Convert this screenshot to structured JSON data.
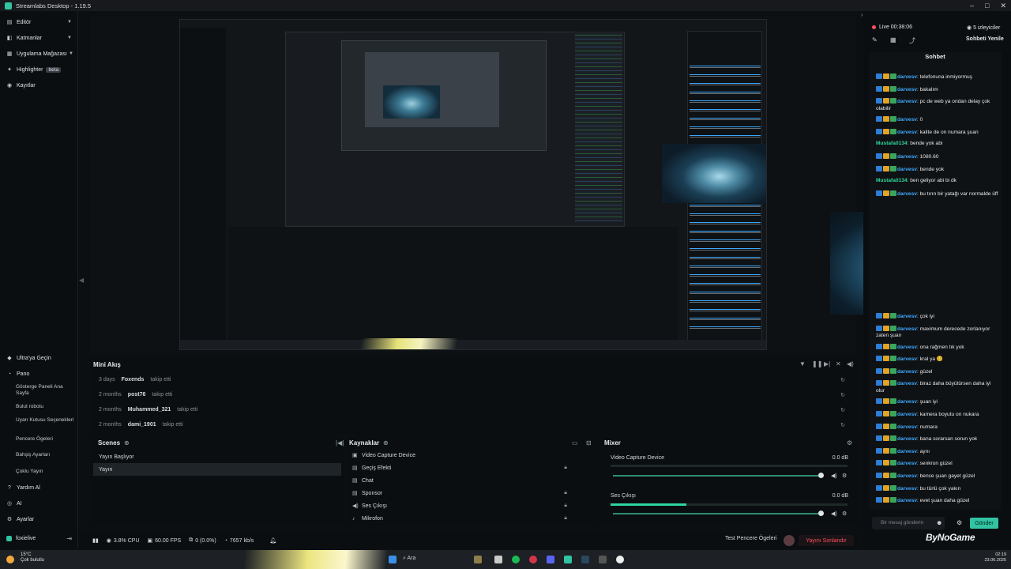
{
  "window": {
    "title": "Streamlabs Desktop - 1.19.5",
    "controls": [
      "–",
      "□",
      "✕"
    ]
  },
  "sidebar": {
    "top_items": [
      {
        "label": "Editör",
        "icon": "editor-icon"
      },
      {
        "label": "Katmanlar",
        "icon": "layers-icon"
      },
      {
        "label": "Uygulama Mağazası",
        "icon": "app-store-icon"
      },
      {
        "label": "Highlighter",
        "badge": "beta",
        "icon": "highlighter-icon"
      },
      {
        "label": "Kayıtlar",
        "icon": "recordings-icon"
      }
    ],
    "bottom_items": {
      "ultra": "Ultra'ya Geçin",
      "pano": "Pano",
      "sub": [
        "Gösterge Paneli Ana Sayfa",
        "Bulut robotu",
        "Uyarı Kutusu Seçenekleri",
        "Pencere Ögeleri",
        "Bahşiş Ayarları",
        "Çoklu Yayın"
      ],
      "help": "Yardım Al",
      "ai": "AI",
      "settings": "Ayarlar",
      "user": "foxielive"
    }
  },
  "mini_feed": {
    "title": "Mini Akış",
    "rows": [
      {
        "time": "3 days",
        "user": "Foxends",
        "action": "takip etti"
      },
      {
        "time": "2 months",
        "user": "post76",
        "action": "takip etti"
      },
      {
        "time": "2 months",
        "user": "Muhammed_321",
        "action": "takip etti"
      },
      {
        "time": "2 months",
        "user": "dami_1901",
        "action": "takip etti"
      }
    ]
  },
  "scenes": {
    "title": "Scenes",
    "items": [
      "Yayın Başlıyor",
      "Yayın"
    ]
  },
  "sources": {
    "title": "Kaynaklar",
    "items": [
      "Video Capture Device",
      "Geçiş Efekti",
      "Chat",
      "Sponsor",
      "Ses Çıkışı",
      "Mikrofon"
    ]
  },
  "mixer": {
    "title": "Mixer",
    "channels": [
      {
        "name": "Video Capture Device",
        "db": "0.0 dB"
      },
      {
        "name": "Ses Çıkışı",
        "db": "0.0 dB"
      }
    ]
  },
  "status": {
    "cpu": "3.8% CPU",
    "fps": "60.00 FPS",
    "dropped": "0 (0.0%)",
    "bitrate": "7657 kb/s",
    "test": "Test Pencere Ögeleri",
    "end": "Yayını Sonlandır"
  },
  "stream": {
    "live": "Live 00:38:06",
    "viewers": "5 izleyiciler",
    "refresh": "Sohbeti Yenile"
  },
  "chat": {
    "title": "Sohbet",
    "messages_top": [
      {
        "user": "darvesv",
        "text": "telefonuna inmiyormuş"
      },
      {
        "user": "darvesv",
        "text": "bakalım"
      },
      {
        "user": "darvesv",
        "text": "pc de web ya ondan delay çok olabilir"
      },
      {
        "user": "darvesv",
        "text": "0"
      },
      {
        "user": "darvesv",
        "text": "kalite de on numara şuan"
      },
      {
        "user": "Mustafa0134",
        "text": "bende yok abi",
        "plain": true
      },
      {
        "user": "darvesv",
        "text": "1080.60"
      },
      {
        "user": "darvesv",
        "text": "bende yok"
      },
      {
        "user": "Mustafa0134",
        "text": "ben geliyor abi bi dk",
        "plain": true
      },
      {
        "user": "darvesv",
        "text": "bu tırın bir yatağı var normalde üff"
      }
    ],
    "messages_bottom": [
      {
        "user": "darvesv",
        "text": "çok iyi"
      },
      {
        "user": "darvesv",
        "text": "maximum derecede zorlanıyor zaten şuan"
      },
      {
        "user": "darvesv",
        "text": "ona rağmen tık yok"
      },
      {
        "user": "darvesv",
        "text": "kral ya 😊"
      },
      {
        "user": "darvesv",
        "text": "güzel"
      },
      {
        "user": "darvesv",
        "text": "biraz daha büyütürsen daha iyi olur"
      },
      {
        "user": "darvesv",
        "text": "şuan iyi"
      },
      {
        "user": "darvesv",
        "text": "kamera boyutu on nukara"
      },
      {
        "user": "darvesv",
        "text": "numara"
      },
      {
        "user": "darvesv",
        "text": "bana sorarsan sorun yok"
      },
      {
        "user": "darvesv",
        "text": "aynı"
      },
      {
        "user": "darvesv",
        "text": "senkron güzel"
      },
      {
        "user": "darvesv",
        "text": "bence şuan gayet güzel"
      },
      {
        "user": "darvesv",
        "text": "bu türlü çok yakın"
      },
      {
        "user": "darvesv",
        "text": "evet şuan daha güzel"
      }
    ],
    "input_placeholder": "Bir mesaj gönderin",
    "send": "Gönder"
  },
  "brand": "ByNoGame",
  "taskbar": {
    "temp": "15°C",
    "weather": "Çok bulutlu",
    "search": "Ara",
    "time": "02:19",
    "date": "23.06.2025"
  },
  "accent": "#31c3a2"
}
